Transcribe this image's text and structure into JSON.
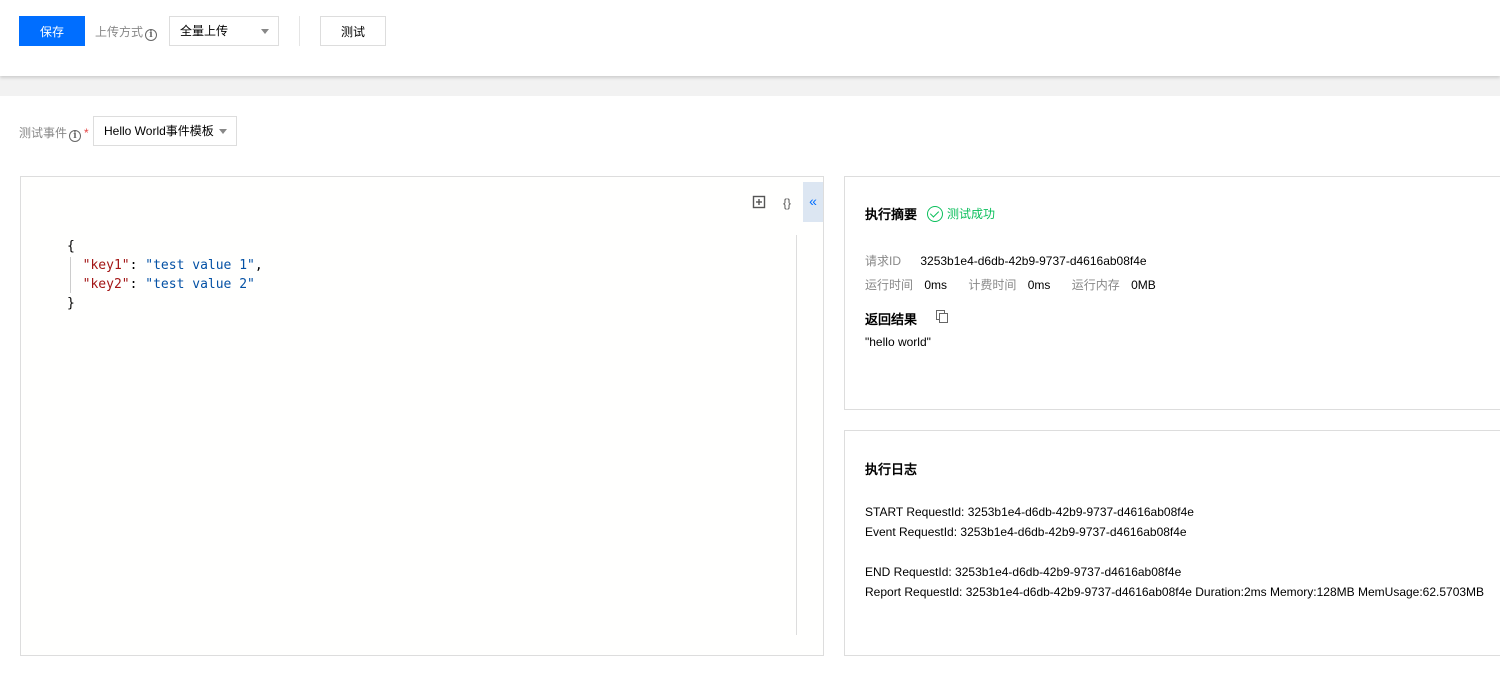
{
  "toolbar": {
    "save_label": "保存",
    "upload_method_label": "上传方式",
    "upload_method_value": "全量上传",
    "test_label": "测试"
  },
  "event": {
    "label": "测试事件",
    "required_mark": "*",
    "selected": "Hello World事件模板"
  },
  "editor": {
    "code_lines": [
      {
        "open": "{"
      },
      {
        "key": "\"key1\"",
        "sep": ": ",
        "value": "\"test value 1\"",
        "trail": ","
      },
      {
        "key": "\"key2\"",
        "sep": ": ",
        "value": "\"test value 2\"",
        "trail": ""
      },
      {
        "close": "}"
      }
    ],
    "format_icon_glyph": "{}",
    "collapse_glyph": "«"
  },
  "summary": {
    "title": "执行摘要",
    "status": "测试成功",
    "request_id_label": "请求ID",
    "request_id": "3253b1e4-d6db-42b9-9737-d4616ab08f4e",
    "run_time_label": "运行时间",
    "run_time": "0ms",
    "billed_time_label": "计费时间",
    "billed_time": "0ms",
    "memory_label": "运行内存",
    "memory": "0MB",
    "result_title": "返回结果",
    "result": "\"hello world\""
  },
  "log": {
    "title": "执行日志",
    "lines": [
      "START RequestId: 3253b1e4-d6db-42b9-9737-d4616ab08f4e",
      "Event RequestId: 3253b1e4-d6db-42b9-9737-d4616ab08f4e",
      "",
      "END RequestId: 3253b1e4-d6db-42b9-9737-d4616ab08f4e",
      "Report RequestId: 3253b1e4-d6db-42b9-9737-d4616ab08f4e Duration:2ms Memory:128MB MemUsage:62.5703MB"
    ]
  },
  "colors": {
    "primary": "#006eff",
    "success": "#0abf5b",
    "json_key": "#a31515",
    "json_string": "#0451a5"
  }
}
